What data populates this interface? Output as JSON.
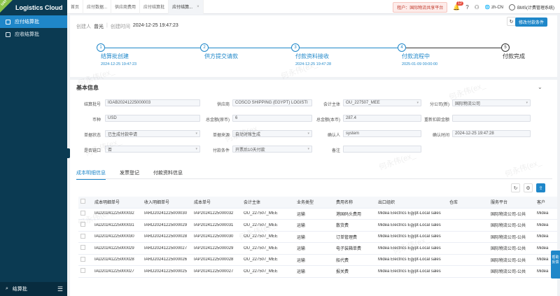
{
  "app": {
    "title": "Logistics Cloud",
    "corner_badge": "UAT"
  },
  "sidebar": {
    "items": [
      {
        "label": "应付结算批",
        "active": true
      },
      {
        "label": "应收结算批",
        "active": false
      }
    ],
    "search_label": "结算批"
  },
  "tabs": [
    {
      "label": "首页"
    },
    {
      "label": "应付数据..."
    },
    {
      "label": "供应商费用"
    },
    {
      "label": "应付结算批"
    },
    {
      "label": "应付结算...",
      "active": true
    }
  ],
  "header": {
    "tenant": "租户：国际物流共享平台",
    "notifications": "12",
    "lang": "zh-CN",
    "user": "BMS(计费管理系统)"
  },
  "creator": {
    "label": "创建人",
    "name": "曾光",
    "time_label": "创建时间",
    "time": "2024-12-25 19:47:23"
  },
  "actions": {
    "modify_payment": "修改付款条件"
  },
  "steps": [
    {
      "num": "1",
      "label": "结算批创建",
      "time": "2024-12-25 19:47:23"
    },
    {
      "num": "2",
      "label": "供方提交请款",
      "time": ""
    },
    {
      "num": "3",
      "label": "付款资料接收",
      "time": "2024-12-25 19:47:28"
    },
    {
      "num": "4",
      "label": "付款流程中",
      "time": "2025-01-09 00:00:00"
    },
    {
      "num": "5",
      "label": "付款完成",
      "time": ""
    }
  ],
  "basic_info": {
    "title": "基本信息"
  },
  "form": {
    "batch_no_label": "结算批号",
    "batch_no": "IGAB20241225000003",
    "supplier_label": "供应商",
    "supplier": "COSCO SHIPPING (EGYPT) LOGISTI",
    "accounting_label": "会计主体",
    "accounting": "OU_227507_MEE",
    "branch_label": "分公司(新)",
    "branch": "国际物流公司",
    "currency_label": "币种",
    "currency": "USD",
    "total_orig_label": "总金额(原币)",
    "total_orig": "6",
    "total_local_label": "总金额(本币)",
    "total_local": "287.4",
    "deduct_label": "重新扣款金额",
    "deduct": "",
    "status_label": "单据状态",
    "status": "已生成付款申请",
    "source_label": "单据来源",
    "source": "自动对账生成",
    "confirmer_label": "确认人",
    "confirmer": "system",
    "confirm_time_label": "确认时间",
    "confirm_time": "2024-12-25 19:47:28",
    "linked_label": "是否链口",
    "linked": "否",
    "pay_terms_label": "付款条件",
    "pay_terms": "开票后10天付款",
    "remark_label": "备注",
    "remark": ""
  },
  "detail_tabs": [
    {
      "label": "成本明细信息",
      "active": true
    },
    {
      "label": "发票登记"
    },
    {
      "label": "付款资料信息"
    }
  ],
  "table": {
    "columns": [
      "成本明细单号",
      "收入明细单号",
      "成本单号",
      "会计主体",
      "业务类型",
      "费用名称",
      "出口组织",
      "仓库",
      "服务平台",
      "客户"
    ],
    "rows": [
      [
        "IAD20241225000032",
        "IARD20241225000030",
        "IAP20241225000032",
        "OU_227507_MEE",
        "运输",
        "港国码头费用",
        "Midea Electrics Egypt-Local sales",
        "",
        "国际物流公司-公共",
        "Midea"
      ],
      [
        "IAD20241225000031",
        "IARD20241225000029",
        "IAP20241225000031",
        "OU_227507_MEE",
        "运输",
        "散货费",
        "Midea Electrics Egypt-Local sales",
        "",
        "国际物流公司-公共",
        "Midea"
      ],
      [
        "IAD20241225000030",
        "IARD20241225000028",
        "IAP20241225000030",
        "OU_227507_MEE",
        "运输",
        "订单管理费",
        "Midea Electrics Egypt-Local sales",
        "",
        "国际物流公司-公共",
        "Midea"
      ],
      [
        "IAD20241225000029",
        "IARD20241225000027",
        "IAP20241225000029",
        "OU_227507_MEE",
        "运输",
        "电子装箱单费",
        "Midea Electrics Egypt-Local sales",
        "",
        "国际物流公司-公共",
        "Midea"
      ],
      [
        "IAD20241225000028",
        "IARD20241225000026",
        "IAP20241225000028",
        "OU_227507_MEE",
        "运输",
        "船代费",
        "Midea Electrics Egypt-Local sales",
        "",
        "国际物流公司-公共",
        "Midea"
      ],
      [
        "IAD20241225000027",
        "IARD20241225000025",
        "IAP20241225000027",
        "OU_227507_MEE",
        "运输",
        "报关费",
        "Midea Electrics Egypt-Local sales",
        "",
        "国际物流公司-公共",
        "Midea"
      ]
    ]
  },
  "watermark": "何永伟(ex_",
  "help": {
    "label": "帮助反馈"
  }
}
